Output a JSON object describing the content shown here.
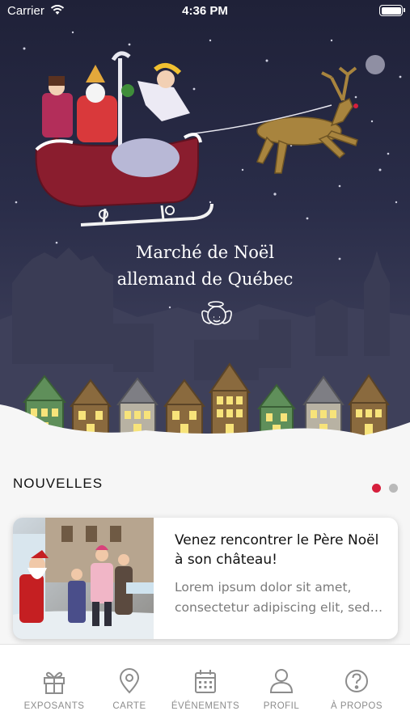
{
  "status_bar": {
    "carrier": "Carrier",
    "time": "4:36 PM"
  },
  "hero": {
    "title_line1": "Marché de Noël",
    "title_line2": "allemand de Québec"
  },
  "news_section": {
    "title": "NOUVELLES",
    "page_count": 2,
    "active_page": 1,
    "items": [
      {
        "title": "Venez rencontrer le Père Noël à son château!",
        "excerpt": "Lorem ipsum dolor sit amet, consectetur adipiscing elit, sed…"
      }
    ]
  },
  "tab_bar": {
    "tabs": [
      {
        "label": "EXPOSANTS",
        "icon": "gift-icon"
      },
      {
        "label": "CARTE",
        "icon": "map-pin-icon"
      },
      {
        "label": "ÉVÉNEMENTS",
        "icon": "calendar-icon"
      },
      {
        "label": "PROFIL",
        "icon": "user-icon"
      },
      {
        "label": "À PROPOS",
        "icon": "question-icon"
      }
    ]
  },
  "colors": {
    "accent": "#d61f3c",
    "hero_background": "#2a2d49",
    "tab_inactive": "#8c8c8c"
  }
}
